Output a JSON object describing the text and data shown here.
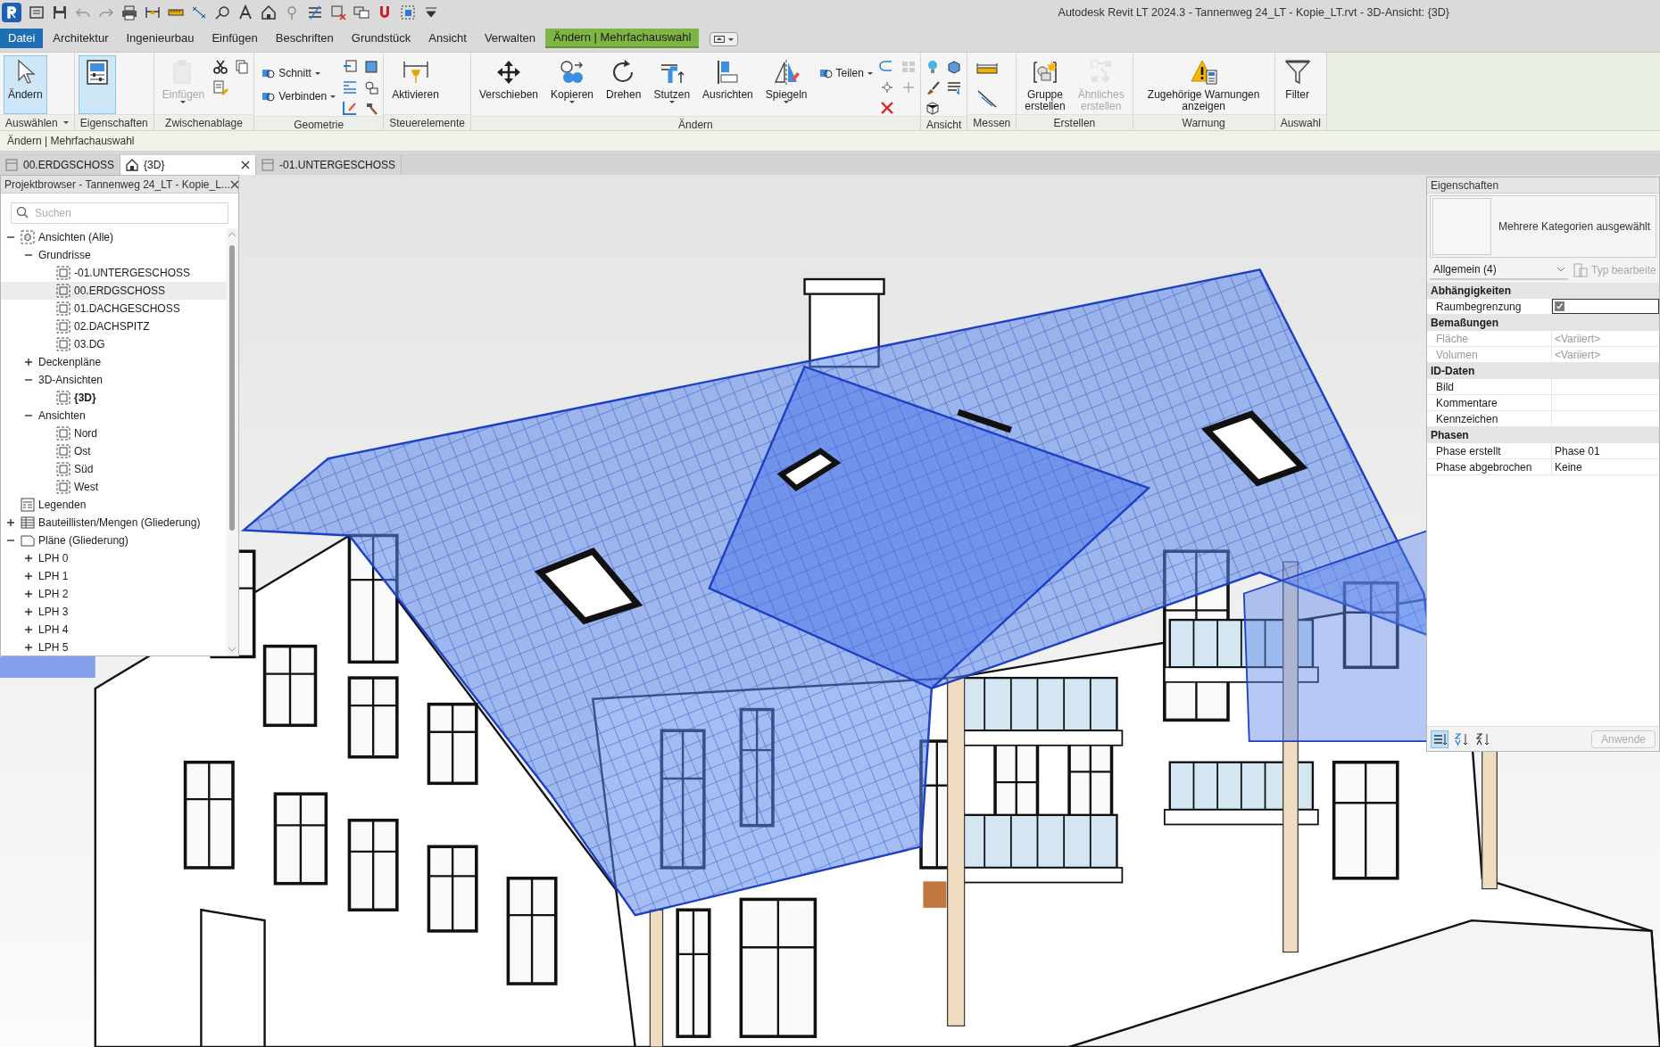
{
  "title_bar": {
    "title": "Autodesk Revit LT 2024.3 - Tannenweg 24_LT - Kopie_LT.rvt - 3D-Ansicht: {3D}"
  },
  "ribbon_tabs": [
    {
      "label": "Datei",
      "kind": "file",
      "selected": false
    },
    {
      "label": "Architektur",
      "kind": "normal",
      "selected": false
    },
    {
      "label": "Ingenieurbau",
      "kind": "normal",
      "selected": false
    },
    {
      "label": "Einfügen",
      "kind": "normal",
      "selected": false
    },
    {
      "label": "Beschriften",
      "kind": "normal",
      "selected": false
    },
    {
      "label": "Grundstück",
      "kind": "normal",
      "selected": false
    },
    {
      "label": "Ansicht",
      "kind": "normal",
      "selected": false
    },
    {
      "label": "Verwalten",
      "kind": "normal",
      "selected": false
    },
    {
      "label": "Ändern | Mehrfachauswahl",
      "kind": "contextual",
      "selected": true
    }
  ],
  "ribbon_panels": [
    {
      "label": "Auswählen",
      "dropdown": true,
      "items": [
        {
          "kind": "large",
          "label": "Ändern",
          "active": true,
          "disabled": false,
          "dropdown": false
        }
      ]
    },
    {
      "label": "Eigenschaften",
      "dropdown": false,
      "items": [
        {
          "kind": "icon",
          "active": true,
          "disabled": false,
          "dropdown": false
        }
      ]
    },
    {
      "label": "Zwischenablage",
      "dropdown": false,
      "items": [
        {
          "kind": "large",
          "label": "Einfügen",
          "active": false,
          "disabled": true,
          "dropdown": true
        }
      ]
    },
    {
      "label": "Geometrie",
      "dropdown": false,
      "items": [
        {
          "kind": "small",
          "label": "Schnitt",
          "active": false,
          "disabled": false,
          "dropdown": true
        },
        {
          "kind": "small",
          "label": "Verbinden",
          "active": false,
          "disabled": false,
          "dropdown": true
        }
      ]
    },
    {
      "label": "Steuerelemente",
      "dropdown": false,
      "items": [
        {
          "kind": "large",
          "label": "Aktivieren",
          "active": false,
          "disabled": false,
          "dropdown": false
        }
      ]
    },
    {
      "label": "Ändern",
      "dropdown": false,
      "items": [
        {
          "kind": "large",
          "label": "Verschieben",
          "active": false,
          "disabled": false,
          "dropdown": false
        },
        {
          "kind": "large",
          "label": "Kopieren",
          "active": false,
          "disabled": false,
          "dropdown": true
        },
        {
          "kind": "large",
          "label": "Drehen",
          "active": false,
          "disabled": false,
          "dropdown": false
        },
        {
          "kind": "large",
          "label": "Stutzen",
          "active": false,
          "disabled": false,
          "dropdown": true
        },
        {
          "kind": "large",
          "label": "Ausrichten",
          "active": false,
          "disabled": false,
          "dropdown": false
        },
        {
          "kind": "large",
          "label": "Spiegeln",
          "active": false,
          "disabled": false,
          "dropdown": true
        },
        {
          "kind": "small",
          "label": "Teilen",
          "active": false,
          "disabled": false,
          "dropdown": true
        }
      ]
    },
    {
      "label": "Ansicht",
      "dropdown": false
    },
    {
      "label": "Messen",
      "dropdown": false
    },
    {
      "label": "Erstellen",
      "dropdown": false,
      "items": [
        {
          "kind": "large",
          "label": "Gruppe erstellen",
          "active": false,
          "disabled": false,
          "dropdown": false
        },
        {
          "kind": "large",
          "label": "Ähnliches erstellen",
          "active": false,
          "disabled": true,
          "dropdown": false
        }
      ]
    },
    {
      "label": "Warnung",
      "dropdown": false,
      "items": [
        {
          "kind": "large",
          "label": "Zugehörige Warnungen anzeigen",
          "active": false,
          "disabled": false,
          "dropdown": false
        }
      ]
    },
    {
      "label": "Auswahl",
      "dropdown": false,
      "items": [
        {
          "kind": "large",
          "label": "Filter",
          "active": false,
          "disabled": false,
          "dropdown": false
        }
      ]
    }
  ],
  "context_bar": {
    "label": "Ändern | Mehrfachauswahl"
  },
  "view_tabs": [
    {
      "label": "00.ERDGSCHOSS",
      "kind": "plan",
      "selected": false
    },
    {
      "label": "{3D}",
      "kind": "model",
      "selected": true
    },
    {
      "label": "-01.UNTERGESCHOSS",
      "kind": "plan",
      "selected": false
    }
  ],
  "project_browser": {
    "title": "Projektbrowser - Tannenweg 24_LT - Kopie_L...",
    "search": {
      "placeholder": "Suchen"
    },
    "tree": [
      {
        "label": "Ansichten (Alle)",
        "kind": "all_views",
        "expanded": true,
        "selected": false,
        "current": false,
        "children": [
          {
            "label": "Grundrisse",
            "kind": "group",
            "expanded": true,
            "selected": false,
            "current": false,
            "children": [
              {
                "label": "-01.UNTERGESCHOSS",
                "kind": "view",
                "selected": false,
                "current": false
              },
              {
                "label": "00.ERDGSCHOSS",
                "kind": "view",
                "selected": true,
                "current": false
              },
              {
                "label": "01.DACHGESCHOSS",
                "kind": "view",
                "selected": false,
                "current": false
              },
              {
                "label": "02.DACHSPITZ",
                "kind": "view",
                "selected": false,
                "current": false
              },
              {
                "label": "03.DG",
                "kind": "view",
                "selected": false,
                "current": false
              }
            ]
          },
          {
            "label": "Deckenpläne",
            "kind": "group",
            "expanded": false,
            "selected": false,
            "current": false
          },
          {
            "label": "3D-Ansichten",
            "kind": "group",
            "expanded": true,
            "selected": false,
            "current": false,
            "children": [
              {
                "label": "{3D}",
                "kind": "view",
                "selected": false,
                "current": true
              }
            ]
          },
          {
            "label": "Ansichten",
            "kind": "group",
            "expanded": true,
            "selected": false,
            "current": false,
            "children": [
              {
                "label": "Nord",
                "kind": "view",
                "selected": false,
                "current": false
              },
              {
                "label": "Ost",
                "kind": "view",
                "selected": false,
                "current": false
              },
              {
                "label": "Süd",
                "kind": "view",
                "selected": false,
                "current": false
              },
              {
                "label": "West",
                "kind": "view",
                "selected": false,
                "current": false
              }
            ]
          }
        ]
      },
      {
        "label": "Legenden",
        "kind": "legends",
        "selected": false,
        "current": false
      },
      {
        "label": "Bauteillisten/Mengen (Gliederung)",
        "kind": "schedules",
        "expanded": false,
        "selected": false,
        "current": false
      },
      {
        "label": "Pläne (Gliederung)",
        "kind": "sheets",
        "expanded": true,
        "selected": false,
        "current": false,
        "children": [
          {
            "label": "LPH 0",
            "kind": "group",
            "expanded": false,
            "selected": false,
            "current": false
          },
          {
            "label": "LPH 1",
            "kind": "group",
            "expanded": false,
            "selected": false,
            "current": false
          },
          {
            "label": "LPH 2",
            "kind": "group",
            "expanded": false,
            "selected": false,
            "current": false
          },
          {
            "label": "LPH 3",
            "kind": "group",
            "expanded": false,
            "selected": false,
            "current": false
          },
          {
            "label": "LPH 4",
            "kind": "group",
            "expanded": false,
            "selected": false,
            "current": false
          },
          {
            "label": "LPH 5",
            "kind": "group",
            "expanded": false,
            "selected": false,
            "current": false
          }
        ]
      }
    ]
  },
  "properties": {
    "title": "Eigenschaften",
    "type_name": "Mehrere Kategorien ausgewählt",
    "filter": "Allgemein (4)",
    "edit_type": {
      "label": "Typ bearbeite",
      "disabled": true
    },
    "groups": [
      {
        "name": "Abhängigkeiten",
        "rows": [
          {
            "kind": "checkbox",
            "name": "Raumbegrenzung",
            "checked": true,
            "disabled": false
          }
        ]
      },
      {
        "name": "Bemaßungen",
        "rows": [
          {
            "kind": "text",
            "name": "Fläche",
            "value": "<Variiert>",
            "disabled": true
          },
          {
            "kind": "text",
            "name": "Volumen",
            "value": "<Variiert>",
            "disabled": true
          }
        ]
      },
      {
        "name": "ID-Daten",
        "rows": [
          {
            "kind": "text",
            "name": "Bild",
            "disabled": false
          },
          {
            "kind": "text",
            "name": "Kommentare",
            "disabled": false
          },
          {
            "kind": "text",
            "name": "Kennzeichen",
            "disabled": false
          }
        ]
      },
      {
        "name": "Phasen",
        "rows": [
          {
            "kind": "text",
            "name": "Phase erstellt",
            "value": "Phase 01",
            "disabled": false
          },
          {
            "kind": "text",
            "name": "Phase abgebrochen",
            "value": "Keine",
            "disabled": false
          }
        ]
      }
    ],
    "view_modes": [
      {
        "selected": true
      },
      {
        "selected": false
      },
      {
        "selected": false
      }
    ],
    "apply": {
      "label": "Anwende",
      "disabled": true
    }
  }
}
